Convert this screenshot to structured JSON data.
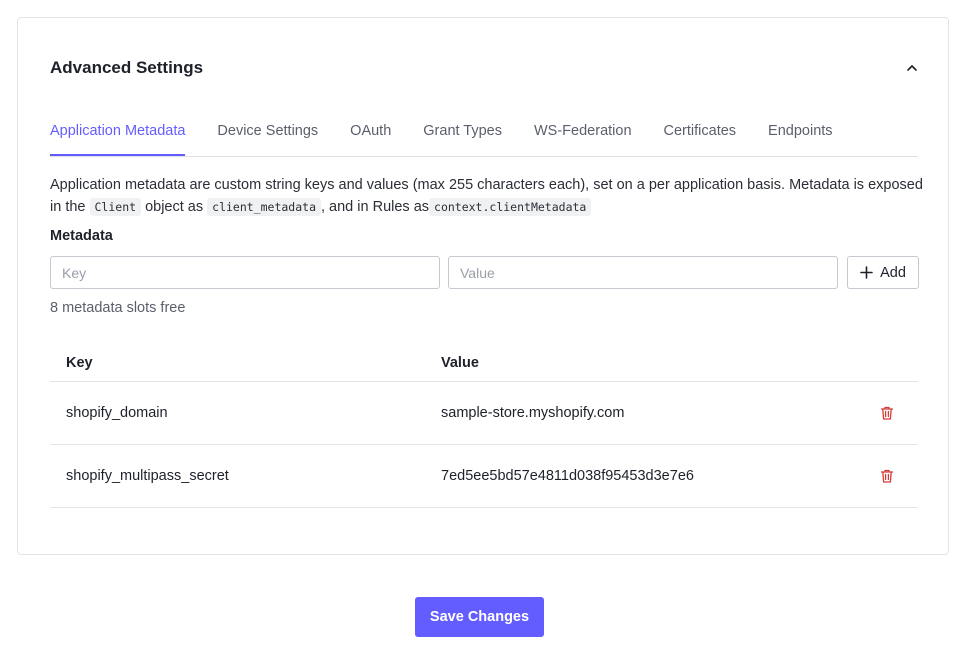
{
  "section": {
    "title": "Advanced Settings"
  },
  "tabs": [
    {
      "label": "Application Metadata",
      "active": true
    },
    {
      "label": "Device Settings"
    },
    {
      "label": "OAuth"
    },
    {
      "label": "Grant Types"
    },
    {
      "label": "WS-Federation"
    },
    {
      "label": "Certificates"
    },
    {
      "label": "Endpoints"
    }
  ],
  "description": {
    "part1": "Application metadata are custom string keys and values (max 255 characters each), set on a per application basis. Metadata is exposed in the ",
    "code1": "Client",
    "part2": " object as ",
    "code2": "client_metadata",
    "part3": ", and in Rules as",
    "code3": "context.clientMetadata"
  },
  "metadata": {
    "label": "Metadata",
    "key_placeholder": "Key",
    "value_placeholder": "Value",
    "add_label": "Add",
    "slots_text": "8 metadata slots free"
  },
  "table": {
    "headers": {
      "key": "Key",
      "value": "Value"
    },
    "rows": [
      {
        "key": "shopify_domain",
        "value": "sample-store.myshopify.com"
      },
      {
        "key": "shopify_multipass_secret",
        "value": "7ed5ee5bd57e4811d038f95453d3e7e6"
      }
    ]
  },
  "footer": {
    "save_label": "Save Changes"
  },
  "colors": {
    "accent": "#635dff",
    "danger": "#d03c38"
  },
  "icons": {
    "collapse": "chevron-up-icon",
    "add": "plus-icon",
    "delete": "trash-icon"
  }
}
